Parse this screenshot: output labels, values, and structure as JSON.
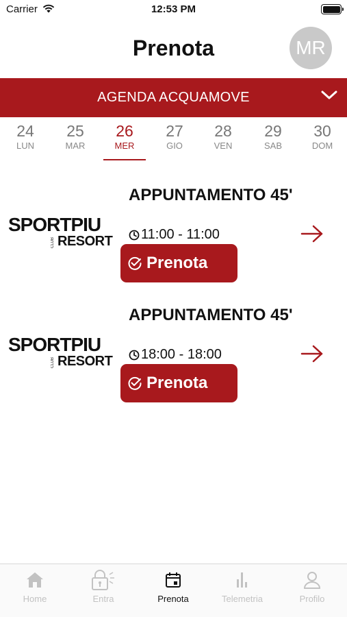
{
  "status_bar": {
    "carrier": "Carrier",
    "time": "12:53 PM",
    "battery_level": 1.0
  },
  "header": {
    "title": "Prenota",
    "avatar_initials": "MR"
  },
  "agenda": {
    "label": "AGENDA ACQUAMOVE",
    "icon": "chevron-down-icon"
  },
  "days": [
    {
      "num": "24",
      "name": "LUN",
      "active": false
    },
    {
      "num": "25",
      "name": "MAR",
      "active": false
    },
    {
      "num": "26",
      "name": "MER",
      "active": true
    },
    {
      "num": "27",
      "name": "GIO",
      "active": false
    },
    {
      "num": "28",
      "name": "VEN",
      "active": false
    },
    {
      "num": "29",
      "name": "SAB",
      "active": false
    },
    {
      "num": "30",
      "name": "DOM",
      "active": false
    }
  ],
  "appointments": [
    {
      "logo_top": "SPORTPIU",
      "logo_club": "CLUB",
      "logo_bottom": "RESORT",
      "title": "APPUNTAMENTO 45'",
      "time": "11:00 - 11:00",
      "button_label": "Prenota"
    },
    {
      "logo_top": "SPORTPIU",
      "logo_club": "CLUB",
      "logo_bottom": "RESORT",
      "title": "APPUNTAMENTO 45'",
      "time": "18:00 - 18:00",
      "button_label": "Prenota"
    }
  ],
  "tabs": [
    {
      "label": "Home",
      "icon": "home-icon",
      "active": false
    },
    {
      "label": "Entra",
      "icon": "lock-icon",
      "active": false
    },
    {
      "label": "Prenota",
      "icon": "calendar-icon",
      "active": true
    },
    {
      "label": "Telemetria",
      "icon": "bar-chart-icon",
      "active": false
    },
    {
      "label": "Profilo",
      "icon": "user-icon",
      "active": false
    }
  ],
  "colors": {
    "accent": "#a8191d",
    "avatar_bg": "#c9c9c9",
    "tab_inactive": "#c2c2c2"
  }
}
